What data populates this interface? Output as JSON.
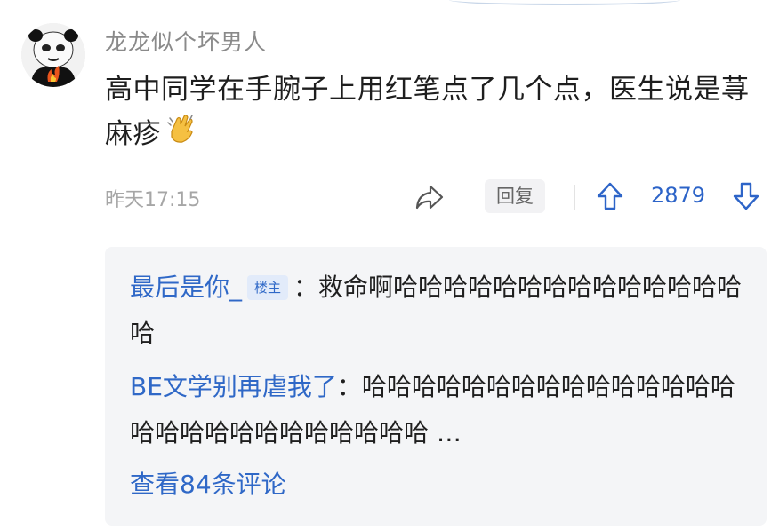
{
  "comment": {
    "username": "龙龙似个坏男人",
    "content": "高中同学在手腕子上用红笔点了几个点，医生说是荨麻疹",
    "emoji": "clapping-hands",
    "time": "昨天17:15",
    "reply_label": "回复",
    "vote_count": "2879"
  },
  "replies": [
    {
      "name": "最后是你_",
      "badge": "楼主",
      "separator": "：",
      "text": "救命啊哈哈哈哈哈哈哈哈哈哈哈哈哈哈哈"
    },
    {
      "name": "BE文学别再虐我了",
      "separator": "：",
      "text": "哈哈哈哈哈哈哈哈哈哈哈哈哈哈哈哈哈哈哈哈哈哈哈哈哈哈哈 …"
    }
  ],
  "view_more": "查看84条评论",
  "colors": {
    "link": "#2f68c7",
    "vote": "#2d64c8",
    "muted": "#8a8a8a",
    "panel": "#f4f5f7"
  }
}
